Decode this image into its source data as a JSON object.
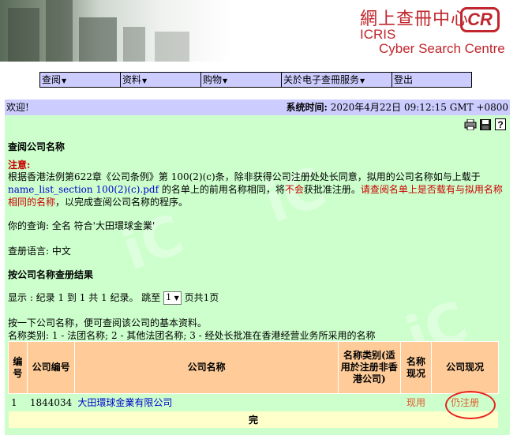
{
  "banner": {
    "logo_cn": "網上查冊中心",
    "logo_mark": "CR",
    "logo_icris": "ICRIS",
    "logo_sub": "Cyber Search Centre"
  },
  "menu": {
    "items": [
      {
        "label": "查阅"
      },
      {
        "label": "资料"
      },
      {
        "label": "购物"
      },
      {
        "label": "关於电子查冊服务"
      },
      {
        "label": "登出"
      }
    ],
    "arrow": "▼"
  },
  "welcome": {
    "text": "欢迎!",
    "time_label": "系统时间:",
    "time_value": "2020年4月22日 09:12:15 GMT +0800"
  },
  "toolbar": {
    "icons": [
      "printer-icon",
      "save-icon",
      "help-icon"
    ]
  },
  "page": {
    "title": "查阅公司名称",
    "notice_label": "注意:",
    "notice_part1": "根据香港法例第622章《公司条例》第 100(2)(c)条，除非获得公司注册处处长同意，拟用的公司名称如与上载于",
    "notice_link": "name_list_section 100(2)(c).pdf",
    "notice_part2": " 的名单上的前用名称相同，将",
    "notice_red1": "不会",
    "notice_part3": "获批准注册。",
    "notice_red2": "请查阅名单上是否载有与拟用名称相同的名称",
    "notice_part4": "，以完成查阅公司名称的程序。",
    "query": "你的查询:  全名 符合'大田環球金業'",
    "language": "查册语言: 中文",
    "results_title": "按公司名称查册结果",
    "display_prefix": "显示 : 纪录 1 到 1 共 1 纪录。 跳至",
    "display_page": "1",
    "display_suffix": "页共1页",
    "hint1": "按一下公司名称，便可查阅该公司的基本资料。",
    "hint2": "名称类别: 1 - 法团名称; 2 - 其他法团名称; 3 - 经处长批准在香港经营业务所采用的名称"
  },
  "table": {
    "headers": {
      "no": "编号",
      "company_no": "公司编号",
      "name": "公司名称",
      "name_type": "名称类别(适用於注册非香港公司)",
      "name_status": "名称现况",
      "company_status": "公司现况"
    },
    "rows": [
      {
        "no": "1",
        "company_no": "1844034",
        "name": "大田環球金業有限公司",
        "name_type": "",
        "name_status": "现用",
        "company_status": "仍注册"
      }
    ],
    "end_label": "完"
  },
  "colors": {
    "menu_bg": "#ccccff",
    "content_bg": "#ccffcc",
    "header_bg": "#ffcc99",
    "end_bg": "#ffffcc",
    "notice_red": "#cc0000",
    "link_blue": "#0000cc",
    "status_orange": "#e25a2b",
    "logo_red": "#c0262d"
  }
}
